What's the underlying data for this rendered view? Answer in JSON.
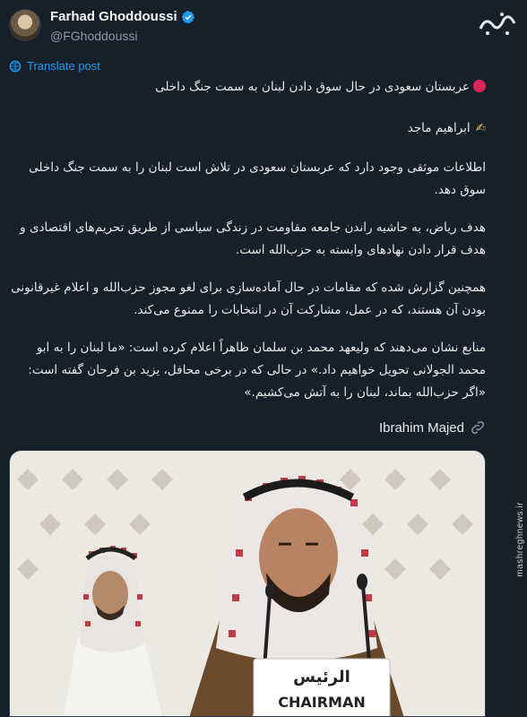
{
  "author": {
    "name": "Farhad Ghoddoussi",
    "handle": "@FGhoddoussi",
    "verified_icon": "verified-badge-icon",
    "verified_color": "#1d9bf0"
  },
  "translate": {
    "label": "Translate post",
    "icon": "globe-icon"
  },
  "post": {
    "headline": "عربستان سعودی در حال سوق دادن لبنان به سمت جنگ داخلی",
    "author_line": "ابراهیم ماجد",
    "paragraph_1": "اطلاعات موثقی وجود دارد که عربستان سعودی در تلاش است لبنان را به سمت جنگ داخلی سوق دهد.",
    "paragraph_2": "هدف ریاض، به حاشیه راندن جامعه مقاومت در زندگی سیاسی از طریق تحریم‌های اقتصادی و هدف قرار دادن نهادهای وابسته به حزب‌الله است.",
    "paragraph_3": "همچنین گزارش شده که مقامات در حال آماده‌سازی برای لغو مجوز حزب‌الله و اعلام غیرقانونی بودن آن هستند، که در عمل، مشارکت آن در انتخابات را ممنوع می‌کند.",
    "paragraph_4": "منابع نشان می‌دهند که ولیعهد محمد بن سلمان ظاهراً اعلام کرده است: «ما لبنان را به ابو محمد الجولانی تحویل خواهیم داد.» در حالی که در برخی محافل، یزید بن فرحان گفته است: «اگر حزب‌الله بماند، لبنان را به آتش می‌کشیم.»",
    "link_text": "Ibrahim Majed",
    "link_icon": "link-icon"
  },
  "media": {
    "sign_arabic": "الرئيس",
    "sign_english": "CHAIRMAN"
  },
  "watermark": {
    "logo_text": "مشرق",
    "side_text": "mashreghnews.ir"
  }
}
